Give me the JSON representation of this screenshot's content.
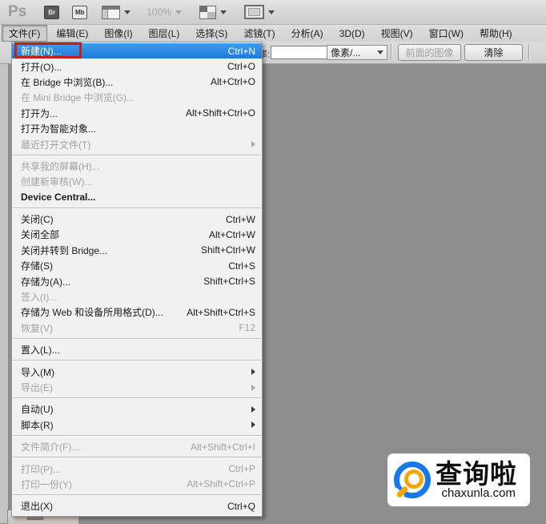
{
  "app_bar": {
    "ps_logo": "Ps",
    "br_icon": "Br",
    "mb_icon": "Mb",
    "zoom_level": "100%"
  },
  "menu_bar": {
    "items": [
      {
        "label": "文件(F)",
        "active": true
      },
      {
        "label": "编辑(E)"
      },
      {
        "label": "图像(I)"
      },
      {
        "label": "图层(L)"
      },
      {
        "label": "选择(S)"
      },
      {
        "label": "滤镜(T)"
      },
      {
        "label": "分析(A)"
      },
      {
        "label": "3D(D)"
      },
      {
        "label": "视图(V)"
      },
      {
        "label": "窗口(W)"
      },
      {
        "label": "帮助(H)"
      }
    ]
  },
  "options_bar": {
    "resolution_label": "率:",
    "resolution_value": "",
    "unit_select": "像素/...",
    "front_image_button": "前面的图像",
    "clear_button": "清除"
  },
  "file_menu": {
    "groups": [
      {
        "items": [
          {
            "label": "新建(N)...",
            "shortcut": "Ctrl+N",
            "highlighted": true,
            "red_box": true
          },
          {
            "label": "打开(O)...",
            "shortcut": "Ctrl+O"
          },
          {
            "label": "在 Bridge 中浏览(B)...",
            "shortcut": "Alt+Ctrl+O"
          },
          {
            "label": "在 Mini Bridge 中浏览(G)...",
            "disabled": true
          },
          {
            "label": "打开为...",
            "shortcut": "Alt+Shift+Ctrl+O"
          },
          {
            "label": "打开为智能对象..."
          },
          {
            "label": "最近打开文件(T)",
            "disabled": true,
            "submenu": true
          }
        ]
      },
      {
        "items": [
          {
            "label": "共享我的屏幕(H)...",
            "disabled": true
          },
          {
            "label": "创建新审核(W)...",
            "disabled": true
          },
          {
            "label": "Device Central...",
            "bold": true
          }
        ]
      },
      {
        "items": [
          {
            "label": "关闭(C)",
            "shortcut": "Ctrl+W"
          },
          {
            "label": "关闭全部",
            "shortcut": "Alt+Ctrl+W"
          },
          {
            "label": "关闭并转到 Bridge...",
            "shortcut": "Shift+Ctrl+W"
          },
          {
            "label": "存储(S)",
            "shortcut": "Ctrl+S"
          },
          {
            "label": "存储为(A)...",
            "shortcut": "Shift+Ctrl+S"
          },
          {
            "label": "签入(I)...",
            "disabled": true
          },
          {
            "label": "存储为 Web 和设备所用格式(D)...",
            "shortcut": "Alt+Shift+Ctrl+S"
          },
          {
            "label": "恢复(V)",
            "shortcut": "F12",
            "disabled": true
          }
        ]
      },
      {
        "items": [
          {
            "label": "置入(L)..."
          }
        ]
      },
      {
        "items": [
          {
            "label": "导入(M)",
            "submenu": true
          },
          {
            "label": "导出(E)",
            "disabled": true,
            "submenu": true
          }
        ]
      },
      {
        "items": [
          {
            "label": "自动(U)",
            "submenu": true
          },
          {
            "label": "脚本(R)",
            "submenu": true
          }
        ]
      },
      {
        "items": [
          {
            "label": "文件简介(F)...",
            "shortcut": "Alt+Shift+Ctrl+I",
            "disabled": true
          }
        ]
      },
      {
        "items": [
          {
            "label": "打印(P)...",
            "shortcut": "Ctrl+P",
            "disabled": true
          },
          {
            "label": "打印一份(Y)",
            "shortcut": "Alt+Shift+Ctrl+P",
            "disabled": true
          }
        ]
      },
      {
        "items": [
          {
            "label": "退出(X)",
            "shortcut": "Ctrl+Q"
          }
        ]
      }
    ]
  },
  "watermark": {
    "title": "查询啦",
    "domain": "chaxunla.com"
  },
  "colors": {
    "highlight_blue": "#2a8ae4",
    "red_box": "#c1201d",
    "logo_blue": "#1778e8",
    "logo_orange": "#f7a600",
    "workspace_gray": "#8d8d8d"
  }
}
